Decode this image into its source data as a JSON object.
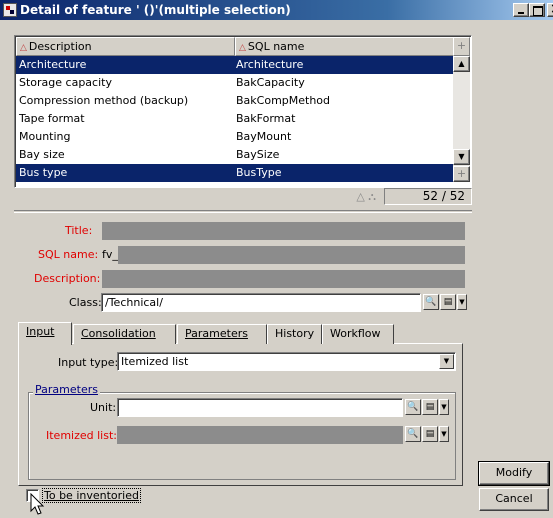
{
  "window": {
    "title": "Detail of feature ' ()'(multiple selection)"
  },
  "list": {
    "columns": [
      "Description",
      "SQL name"
    ],
    "rows": [
      {
        "description": "Architecture",
        "sql_name": "Architecture",
        "selected": true
      },
      {
        "description": "Storage capacity",
        "sql_name": "BakCapacity",
        "selected": false
      },
      {
        "description": "Compression method (backup)",
        "sql_name": "BakCompMethod",
        "selected": false
      },
      {
        "description": "Tape format",
        "sql_name": "BakFormat",
        "selected": false
      },
      {
        "description": "Mounting",
        "sql_name": "BayMount",
        "selected": false
      },
      {
        "description": "Bay size",
        "sql_name": "BaySize",
        "selected": false
      },
      {
        "description": "Bus type",
        "sql_name": "BusType",
        "selected": true
      }
    ],
    "counter": "52 / 52"
  },
  "form": {
    "title_label": "Title:",
    "sql_name_label": "SQL name:",
    "sql_name_prefix": "fv_",
    "description_label": "Description:",
    "class_label": "Class:",
    "class_value": "/Technical/"
  },
  "tabs": [
    "Input",
    "Consolidation",
    "Parameters",
    "History",
    "Workflow"
  ],
  "input_tab": {
    "input_type_label": "Input type:",
    "input_type_value": "Itemized list",
    "parameters_group": "Parameters",
    "unit_label": "Unit:",
    "unit_value": "",
    "itemized_list_label": "Itemized list:"
  },
  "buttons": {
    "modify": "Modify",
    "cancel": "Cancel"
  },
  "checkbox": {
    "to_be_inventoried": "To be inventoried",
    "checked": false
  },
  "colors": {
    "selection": "#0a246a",
    "required_label": "#e00000",
    "disabled_field": "#8c8c8c",
    "dialog_bg": "#d4d0c8"
  }
}
